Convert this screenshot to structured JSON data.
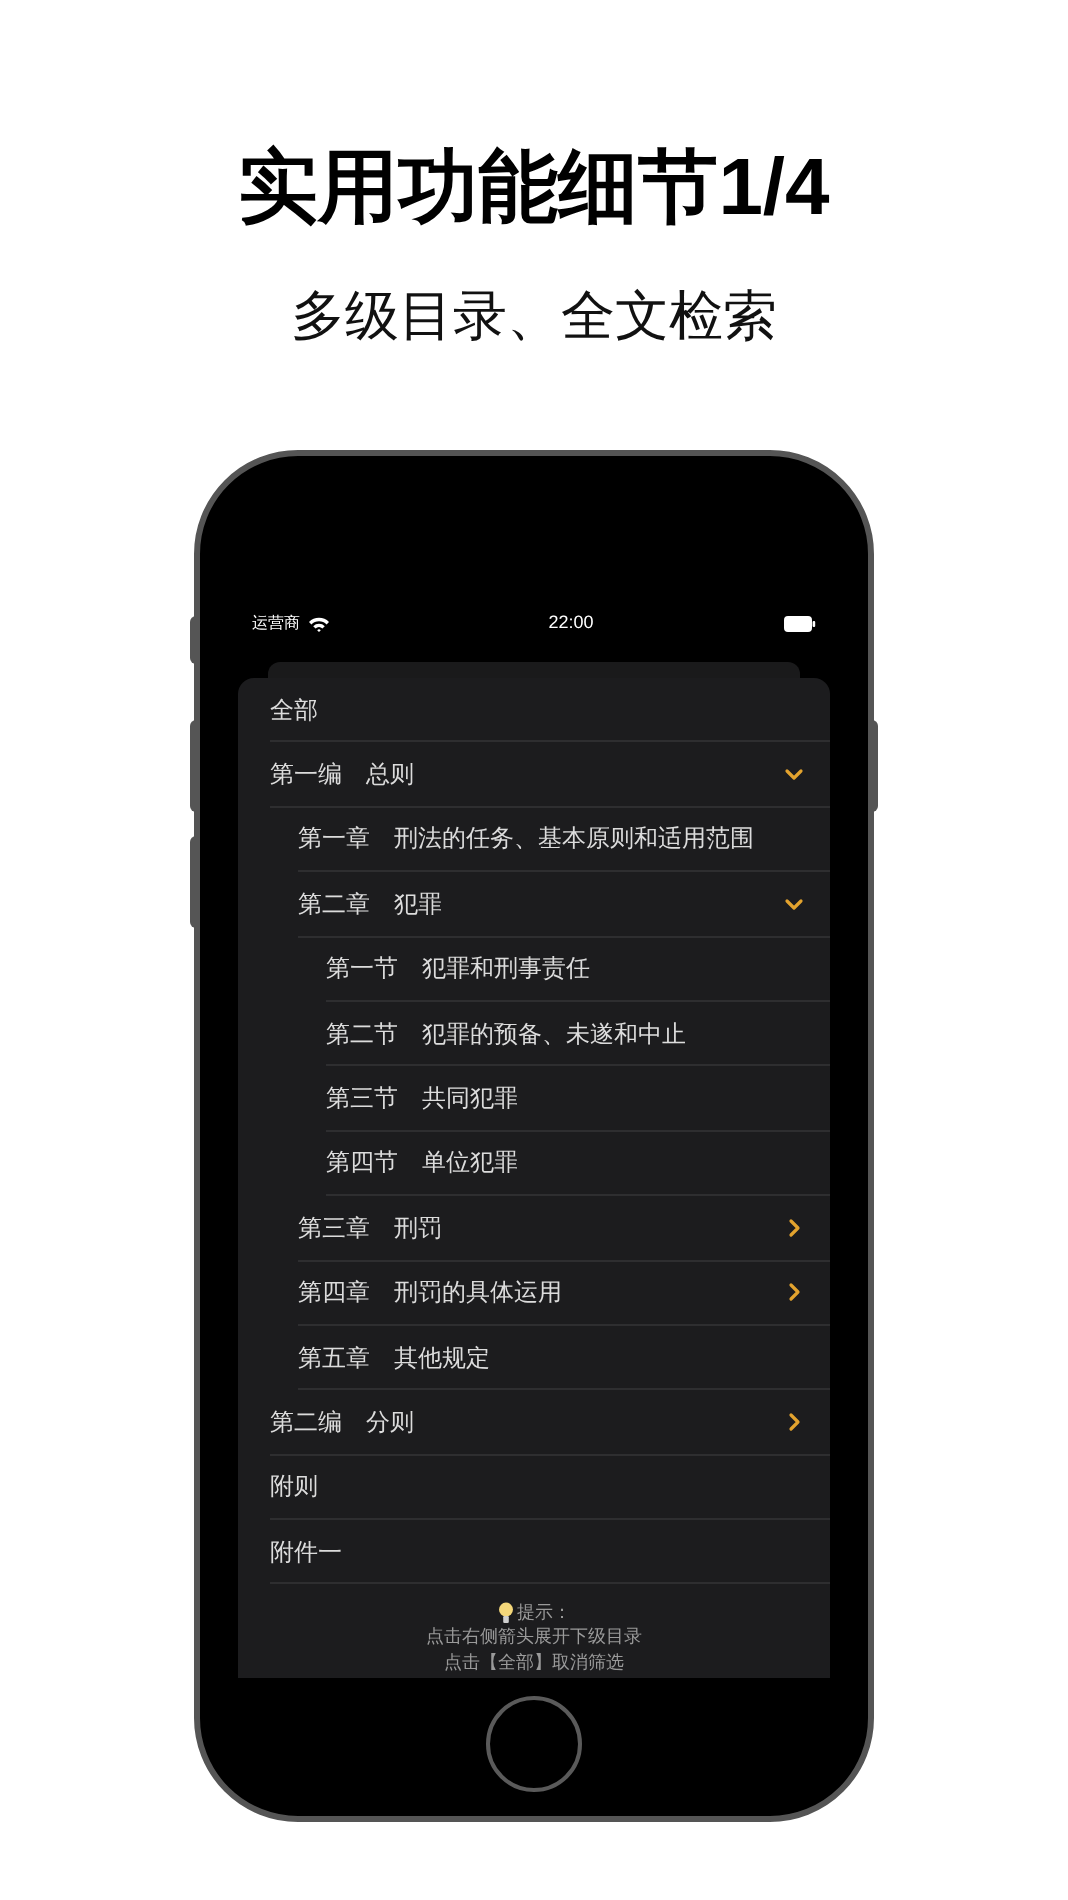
{
  "headline": "实用功能细节1/4",
  "subtitle": "多级目录、全文检索",
  "status_bar": {
    "carrier": "运营商",
    "time": "22:00"
  },
  "toc": [
    {
      "label": "全部"
    },
    {
      "label": "第一编　总则",
      "expanded": true,
      "children": [
        {
          "label": "第一章　刑法的任务、基本原则和适用范围"
        },
        {
          "label": "第二章　犯罪",
          "expanded": true,
          "children": [
            {
              "label": "第一节　犯罪和刑事责任"
            },
            {
              "label": "第二节　犯罪的预备、未遂和中止"
            },
            {
              "label": "第三节　共同犯罪"
            },
            {
              "label": "第四节　单位犯罪"
            }
          ]
        },
        {
          "label": "第三章　刑罚",
          "expanded": false
        },
        {
          "label": "第四章　刑罚的具体运用",
          "expanded": false
        },
        {
          "label": "第五章　其他规定"
        }
      ]
    },
    {
      "label": "第二编　分则",
      "expanded": false
    },
    {
      "label": "附则"
    },
    {
      "label": "附件一"
    }
  ],
  "hint": {
    "title": "提示：",
    "lines": [
      "点击右侧箭头展开下级目录",
      "点击【全部】取消筛选"
    ]
  }
}
